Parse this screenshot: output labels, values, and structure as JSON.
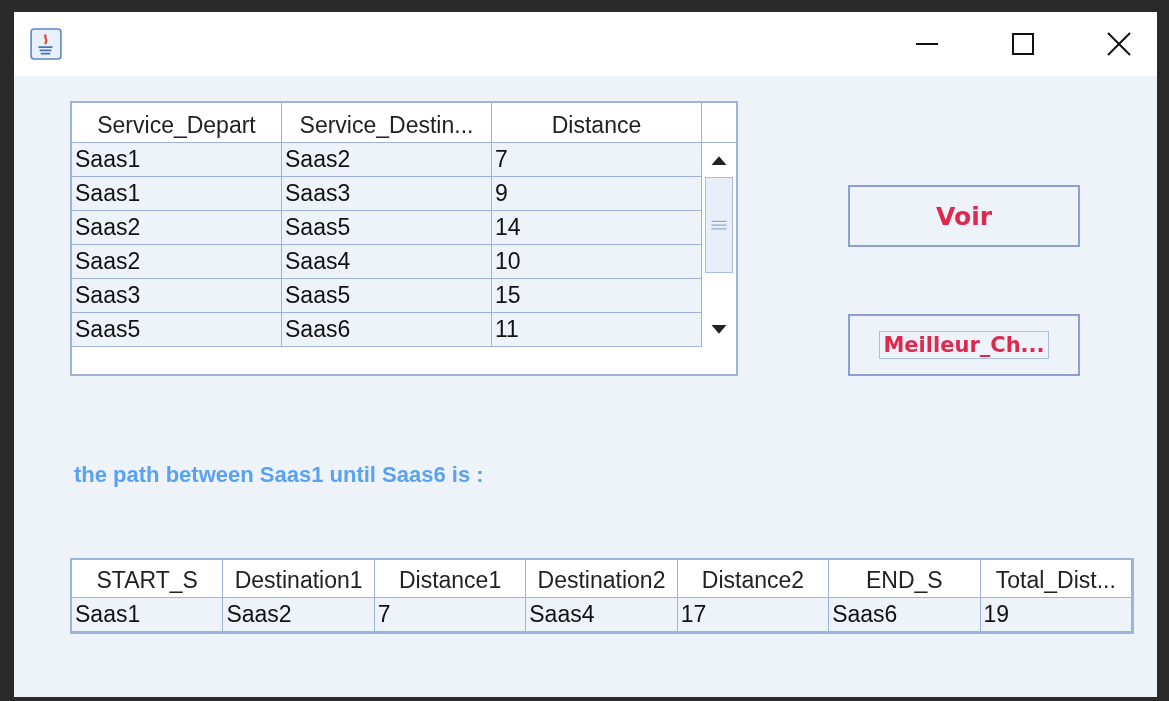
{
  "routes_table": {
    "columns": [
      "Service_Depart",
      "Service_Destin...",
      "Distance"
    ],
    "rows": [
      [
        "Saas1",
        "Saas2",
        "7"
      ],
      [
        "Saas1",
        "Saas3",
        "9"
      ],
      [
        "Saas2",
        "Saas5",
        "14"
      ],
      [
        "Saas2",
        "Saas4",
        "10"
      ],
      [
        "Saas3",
        "Saas5",
        "15"
      ],
      [
        "Saas5",
        "Saas6",
        "11"
      ]
    ]
  },
  "buttons": [
    {
      "label": "Voir",
      "focused": false
    },
    {
      "label": "Meilleur_Ch...",
      "focused": true
    }
  ],
  "path_label": "the path between Saas1 until Saas6 is :",
  "result_table": {
    "columns": [
      "START_S",
      "Destination1",
      "Distance1",
      "Destination2",
      "Distance2",
      "END_S",
      "Total_Dist..."
    ],
    "rows": [
      [
        "Saas1",
        "Saas2",
        "7",
        "Saas4",
        "17",
        "Saas6",
        "19"
      ]
    ]
  }
}
